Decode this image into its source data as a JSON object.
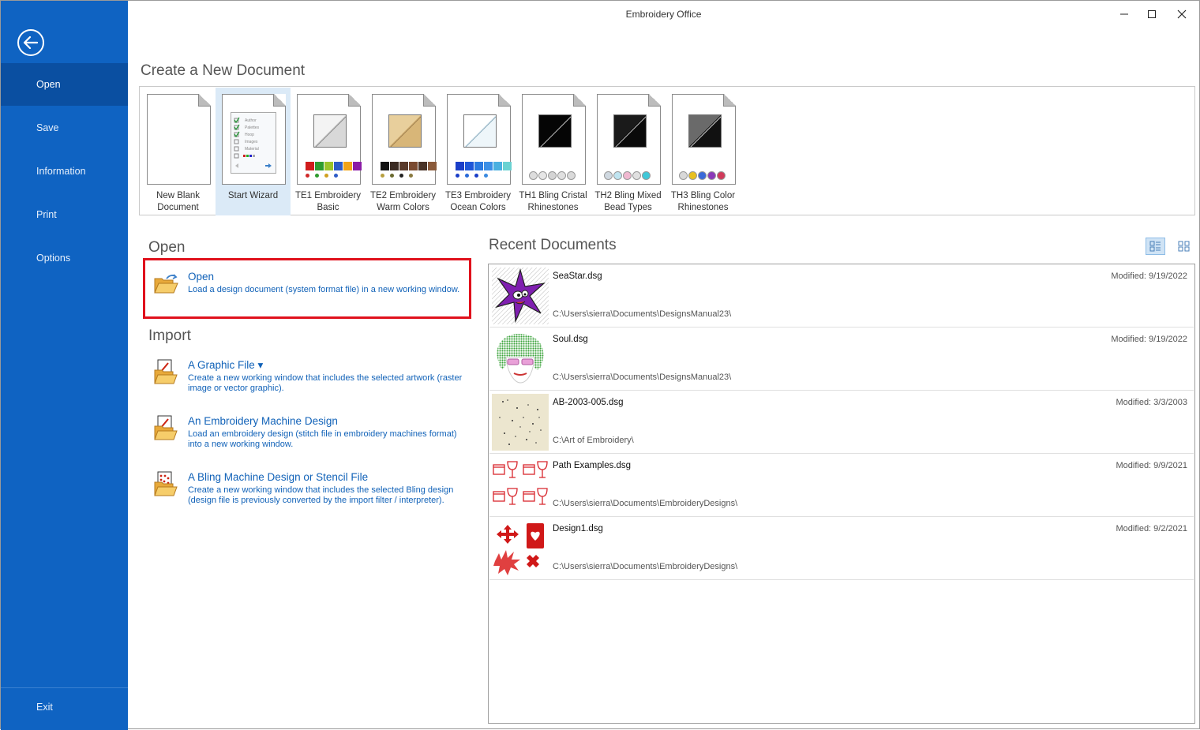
{
  "window": {
    "title": "Embroidery Office"
  },
  "sidebar": {
    "items": [
      {
        "label": "Open"
      },
      {
        "label": "Save"
      },
      {
        "label": "Information"
      },
      {
        "label": "Print"
      },
      {
        "label": "Options"
      },
      {
        "label": "Exit"
      }
    ],
    "active": "Open"
  },
  "new_document": {
    "heading": "Create a New Document",
    "templates": [
      {
        "label": "New Blank Document"
      },
      {
        "label": "Start Wizard"
      },
      {
        "label": "TE1 Embroidery Basic"
      },
      {
        "label": "TE2 Embroidery Warm Colors"
      },
      {
        "label": "TE3 Embroidery Ocean Colors"
      },
      {
        "label": "TH1 Bling Cristal Rhinestones"
      },
      {
        "label": "TH2 Bling Mixed Bead Types"
      },
      {
        "label": "TH3 Bling Color Rhinestones"
      }
    ],
    "wizard_lines": [
      "Author",
      "Palettes",
      "Hoop",
      "Images",
      "Material"
    ]
  },
  "open": {
    "heading": "Open",
    "action": {
      "title": "Open",
      "description": "Load a design document (system format file) in a new working window."
    }
  },
  "import": {
    "heading": "Import",
    "actions": [
      {
        "title": "A Graphic File ▾",
        "description": "Create a new working window that includes the selected artwork (raster image or vector graphic)."
      },
      {
        "title": "An Embroidery Machine Design",
        "description": "Load an embroidery design (stitch file in embroidery machines format) into a new working window."
      },
      {
        "title": "A Bling Machine Design or Stencil File",
        "description": "Create a new working window that includes the selected Bling design (design file is previously converted by the import filter / interpreter)."
      }
    ]
  },
  "recent": {
    "heading": "Recent Documents",
    "items": [
      {
        "name": "SeaStar.dsg",
        "path": "C:\\Users\\sierra\\Documents\\DesignsManual23\\",
        "modified": "Modified: 9/19/2022"
      },
      {
        "name": "Soul.dsg",
        "path": "C:\\Users\\sierra\\Documents\\DesignsManual23\\",
        "modified": "Modified: 9/19/2022"
      },
      {
        "name": "AB-2003-005.dsg",
        "path": "C:\\Art of Embroidery\\",
        "modified": "Modified: 3/3/2003"
      },
      {
        "name": "Path Examples.dsg",
        "path": "C:\\Users\\sierra\\Documents\\EmbroideryDesigns\\",
        "modified": "Modified: 9/9/2021"
      },
      {
        "name": "Design1.dsg",
        "path": "C:\\Users\\sierra\\Documents\\EmbroideryDesigns\\",
        "modified": "Modified: 9/2/2021"
      }
    ]
  },
  "colors": {
    "sidebar": "#0f63c2",
    "sidebar_active": "#0a4fa1",
    "link": "#1162b8",
    "highlight": "#e0111c"
  }
}
